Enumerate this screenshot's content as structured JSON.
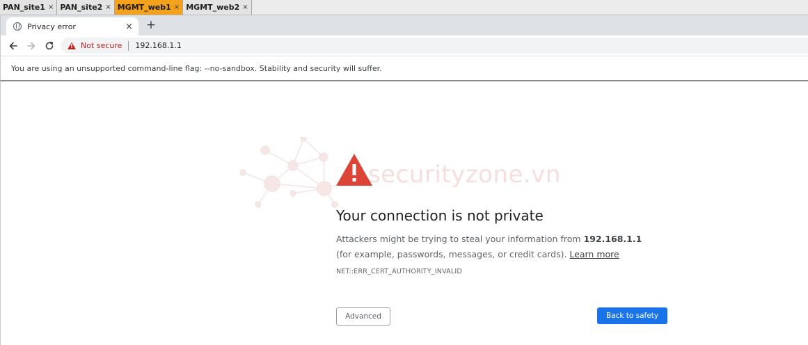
{
  "terminal_tabs": [
    {
      "label": "PAN_site1",
      "active": false
    },
    {
      "label": "PAN_site2",
      "active": false
    },
    {
      "label": "MGMT_web1",
      "active": true
    },
    {
      "label": "MGMT_web2",
      "active": false
    }
  ],
  "tab_close_glyph": "×",
  "browser": {
    "tab": {
      "title": "Privacy error",
      "icon": "globe-icon",
      "close": "×"
    },
    "new_tab": "+",
    "omnibox": {
      "security_label": "Not secure",
      "url": "192.168.1.1"
    },
    "infobar_text": "You are using an unsupported command-line flag: --no-sandbox. Stability and security will suffer."
  },
  "page": {
    "watermark": "securityzone.vn",
    "headline": "Your connection is not private",
    "desc_pre": "Attackers might be trying to steal your information from ",
    "desc_host": "192.168.1.1",
    "desc_post": " (for example, passwords, messages, or credit cards). ",
    "learn_more": "Learn more",
    "error_code": "NET::ERR_CERT_AUTHORITY_INVALID",
    "advanced_label": "Advanced",
    "safety_label": "Back to safety"
  },
  "colors": {
    "active_terminal_tab": "#f4a11c",
    "warning_red": "#c5221f",
    "primary_blue": "#1a73e8"
  }
}
